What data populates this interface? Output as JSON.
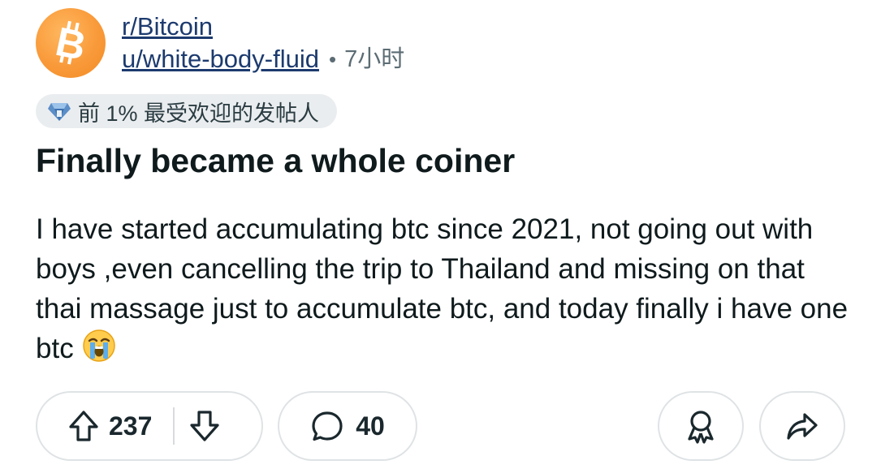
{
  "post": {
    "subreddit": "r/Bitcoin",
    "username": "u/white-body-fluid",
    "separator_dot": "•",
    "time": "7小时",
    "avatar_icon": "bitcoin-logo-icon",
    "avatar_color": "#f7931a",
    "flair": {
      "icon": "top-poster-diamond-icon",
      "text": "前 1% 最受欢迎的发帖人"
    },
    "title": "Finally became a whole coiner",
    "body": "I have started accumulating btc since 2021, not going out with boys ,even cancelling the trip to Thailand and missing on that thai massage just to accumulate btc, and today finally i have one btc",
    "body_emoji": "loudly-crying-face-emoji"
  },
  "actions": {
    "upvote_icon": "upvote-arrow-icon",
    "vote_count": "237",
    "downvote_icon": "downvote-arrow-icon",
    "comment_icon": "comment-bubble-icon",
    "comment_count": "40",
    "award_icon": "award-icon",
    "share_icon": "share-arrow-icon"
  }
}
